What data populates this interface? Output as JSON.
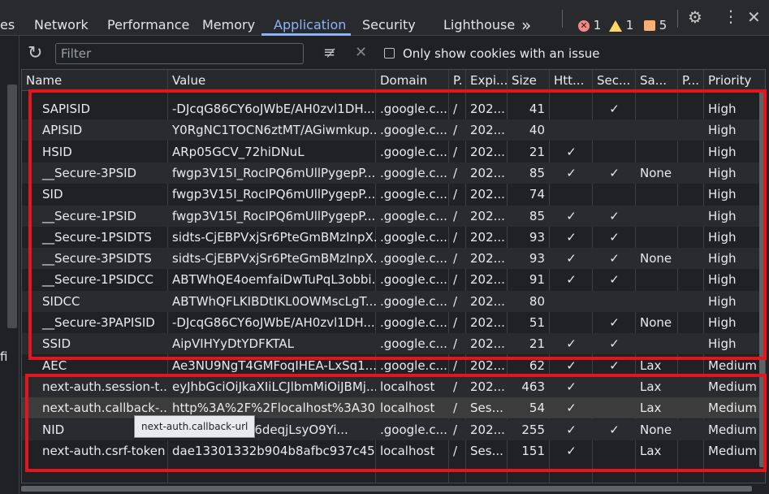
{
  "tabs": {
    "cut": "es",
    "network": "Network",
    "performance": "Performance",
    "memory": "Memory",
    "application": "Application",
    "security": "Security",
    "lighthouse": "Lighthouse",
    "more": "»"
  },
  "status": {
    "errors": "1",
    "warnings": "1",
    "issues": "5"
  },
  "toolbar": {
    "filter_placeholder": "Filter",
    "only_issues_label": "Only show cookies with an issue",
    "only_issues_checked": false
  },
  "gutter_text": "fi",
  "columns": [
    "Name",
    "Value",
    "Domain",
    "P.",
    "Expi...",
    "Size",
    "Htt...",
    "Sec...",
    "Sa...",
    "P...",
    "Priority"
  ],
  "check_glyph": "✓",
  "rows": [
    {
      "name": "SAPISID",
      "value": "-DJcqG86CY6oJWbE/AH0zvl1DH...",
      "domain": ".google.c...",
      "path": "/",
      "expires": "202...",
      "size": "41",
      "http": "",
      "secure": "✓",
      "samesite": "",
      "partition": "",
      "priority": "High"
    },
    {
      "name": "APISID",
      "value": "Y0RgNC1TOCN6ztMT/AGiwmkup...",
      "domain": ".google.c...",
      "path": "/",
      "expires": "202...",
      "size": "40",
      "http": "",
      "secure": "",
      "samesite": "",
      "partition": "",
      "priority": "High"
    },
    {
      "name": "HSID",
      "value": "ARp05GCV_72hiDNuL",
      "domain": ".google.c...",
      "path": "/",
      "expires": "202...",
      "size": "21",
      "http": "✓",
      "secure": "",
      "samesite": "",
      "partition": "",
      "priority": "High"
    },
    {
      "name": "__Secure-3PSID",
      "value": "fwgp3V15I_RocIPQ6mUllPygepP...",
      "domain": ".google.c...",
      "path": "/",
      "expires": "202...",
      "size": "85",
      "http": "✓",
      "secure": "✓",
      "samesite": "None",
      "partition": "",
      "priority": "High"
    },
    {
      "name": "SID",
      "value": "fwgp3V15I_RocIPQ6mUllPygepP...",
      "domain": ".google.c...",
      "path": "/",
      "expires": "202...",
      "size": "74",
      "http": "",
      "secure": "",
      "samesite": "",
      "partition": "",
      "priority": "High"
    },
    {
      "name": "__Secure-1PSID",
      "value": "fwgp3V15I_RocIPQ6mUllPygepP...",
      "domain": ".google.c...",
      "path": "/",
      "expires": "202...",
      "size": "85",
      "http": "✓",
      "secure": "✓",
      "samesite": "",
      "partition": "",
      "priority": "High"
    },
    {
      "name": "__Secure-1PSIDTS",
      "value": "sidts-CjEBPVxjSr6PteGmBMzInpX...",
      "domain": ".google.c...",
      "path": "/",
      "expires": "202...",
      "size": "93",
      "http": "✓",
      "secure": "✓",
      "samesite": "",
      "partition": "",
      "priority": "High"
    },
    {
      "name": "__Secure-3PSIDTS",
      "value": "sidts-CjEBPVxjSr6PteGmBMzInpX...",
      "domain": ".google.c...",
      "path": "/",
      "expires": "202...",
      "size": "93",
      "http": "✓",
      "secure": "✓",
      "samesite": "None",
      "partition": "",
      "priority": "High"
    },
    {
      "name": "__Secure-1PSIDCC",
      "value": "ABTWhQE4oemfaiDwTuPqL3obbi...",
      "domain": ".google.c...",
      "path": "/",
      "expires": "202...",
      "size": "91",
      "http": "✓",
      "secure": "✓",
      "samesite": "",
      "partition": "",
      "priority": "High"
    },
    {
      "name": "SIDCC",
      "value": "ABTWhQFLKIBDtIKL0OWMscLgT...",
      "domain": ".google.c...",
      "path": "/",
      "expires": "202...",
      "size": "80",
      "http": "",
      "secure": "",
      "samesite": "",
      "partition": "",
      "priority": "High"
    },
    {
      "name": "__Secure-3PAPISID",
      "value": "-DJcqG86CY6oJWbE/AH0zvl1DH...",
      "domain": ".google.c...",
      "path": "/",
      "expires": "202...",
      "size": "51",
      "http": "",
      "secure": "✓",
      "samesite": "None",
      "partition": "",
      "priority": "High"
    },
    {
      "name": "SSID",
      "value": "AipVIHYyDtYDFKTAL",
      "domain": ".google.c...",
      "path": "/",
      "expires": "202...",
      "size": "21",
      "http": "✓",
      "secure": "✓",
      "samesite": "",
      "partition": "",
      "priority": "High"
    },
    {
      "name": "AEC",
      "value": "Ae3NU9NgT4GMFoqIHEA-LxSq1...",
      "domain": ".google.c...",
      "path": "/",
      "expires": "202...",
      "size": "62",
      "http": "✓",
      "secure": "✓",
      "samesite": "Lax",
      "partition": "",
      "priority": "Medium"
    },
    {
      "name": "next-auth.session-t...",
      "value": "eyJhbGciOiJkaXIiLCJlbmMiOiJBMj...",
      "domain": "localhost",
      "path": "/",
      "expires": "202...",
      "size": "463",
      "http": "✓",
      "secure": "",
      "samesite": "Lax",
      "partition": "",
      "priority": "Medium"
    },
    {
      "name": "next-auth.callback-...",
      "value": "http%3A%2F%2Flocalhost%3A30...",
      "domain": "localhost",
      "path": "/",
      "expires": "Ses...",
      "size": "54",
      "http": "✓",
      "secure": "",
      "samesite": "Lax",
      "partition": "",
      "priority": "Medium"
    },
    {
      "name": "NID",
      "value": "511=ScwZbB6deqjLsyO9Yi...",
      "domain": ".google.c...",
      "path": "/",
      "expires": "202...",
      "size": "255",
      "http": "✓",
      "secure": "✓",
      "samesite": "None",
      "partition": "",
      "priority": "Medium"
    },
    {
      "name": "next-auth.csrf-token",
      "value": "dae13301332b904b8afbc937c45...",
      "domain": "localhost",
      "path": "/",
      "expires": "Ses...",
      "size": "151",
      "http": "✓",
      "secure": "",
      "samesite": "Lax",
      "partition": "",
      "priority": "Medium"
    }
  ],
  "tooltip": "next-auth.callback-url",
  "colors": {
    "accent": "#8ab4f8",
    "highlight_border": "#e5151c",
    "background": "#202124"
  }
}
